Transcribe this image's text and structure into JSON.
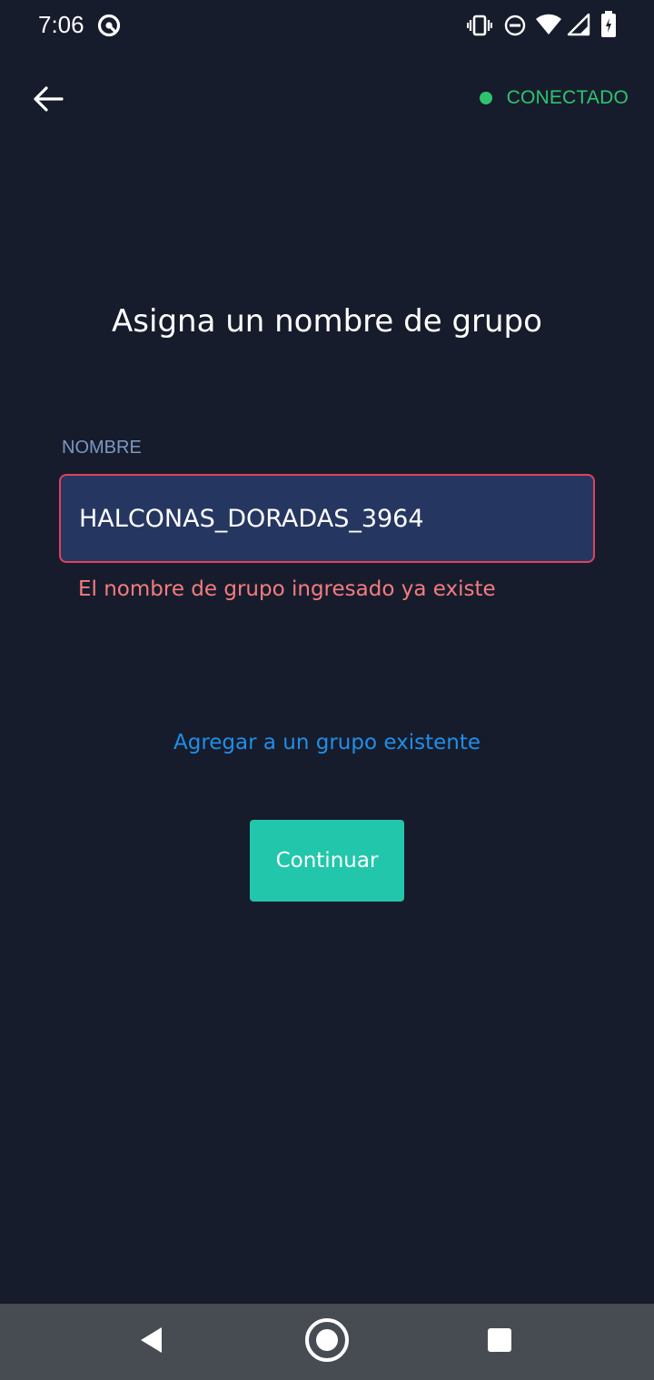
{
  "status_bar": {
    "time": "7:06",
    "icons": [
      "vpn-icon",
      "vibrate-icon",
      "dnd-icon",
      "wifi-icon",
      "signal-icon",
      "battery-icon"
    ]
  },
  "header": {
    "back_icon": "back-arrow-icon",
    "connection_status": "CONECTADO"
  },
  "main": {
    "title": "Asigna un nombre de grupo",
    "field_label": "NOMBRE",
    "name_value": "HALCONAS_DORADAS_3964",
    "error_message": "El nombre de grupo ingresado ya existe",
    "existing_group_link": "Agregar a un grupo existente",
    "continue_label": "Continuar"
  },
  "nav_bar": {
    "items": [
      "nav-back-icon",
      "nav-home-icon",
      "nav-recents-icon"
    ]
  },
  "colors": {
    "background": "#171c2c",
    "connected_green": "#2ec46f",
    "label_blue_gray": "#7c97c4",
    "input_fill": "#253761",
    "input_error_border": "#e0415f",
    "error_text": "#f47c80",
    "link_blue": "#1f8fe8",
    "button_teal": "#22c7ab",
    "nav_bar_bg": "#474b52"
  }
}
